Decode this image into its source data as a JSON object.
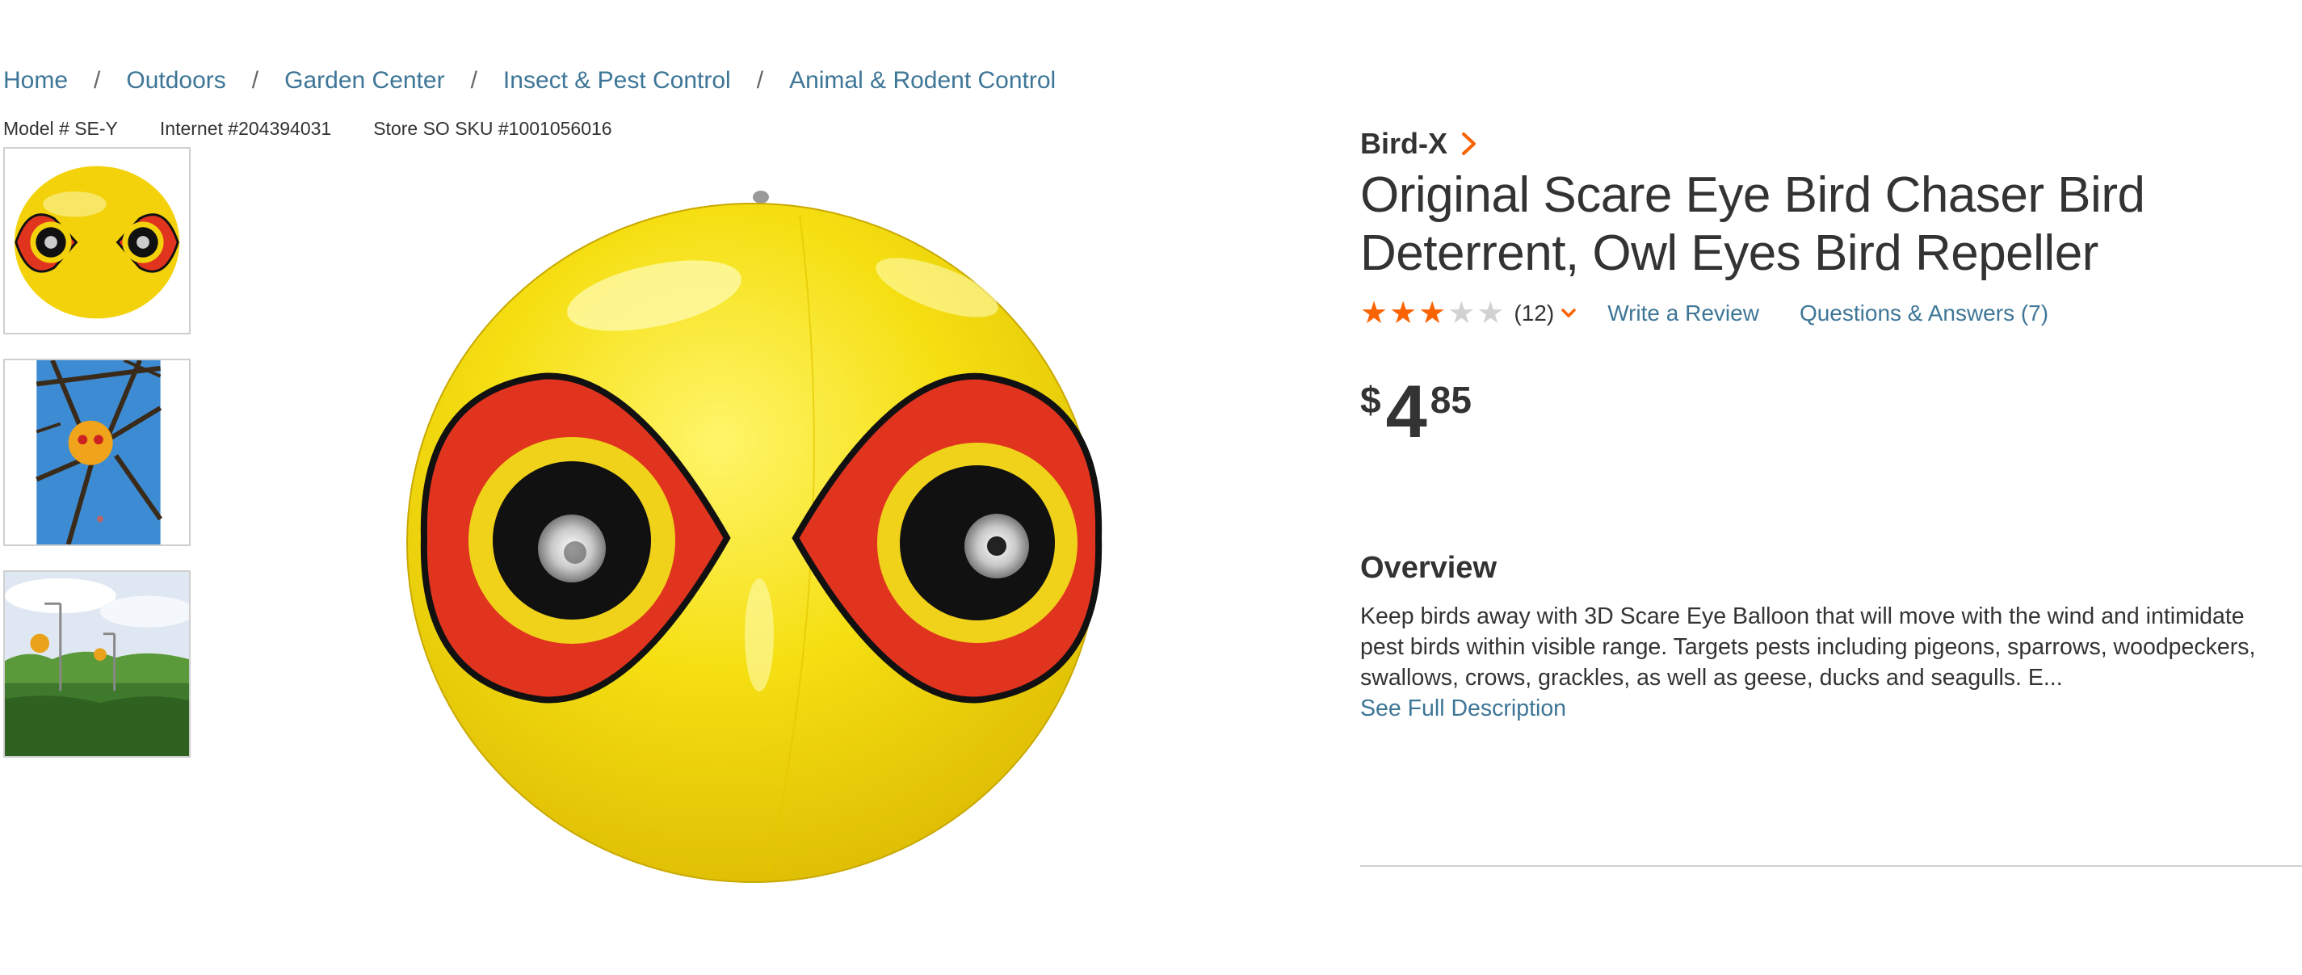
{
  "breadcrumb": {
    "items": [
      {
        "label": "Home"
      },
      {
        "label": "Outdoors"
      },
      {
        "label": "Garden Center"
      },
      {
        "label": "Insect & Pest Control"
      },
      {
        "label": "Animal & Rodent Control"
      }
    ],
    "separator": "/"
  },
  "model_info": {
    "model": "Model # SE-Y",
    "internet": "Internet #204394031",
    "store_sku": "Store SO SKU #1001056016"
  },
  "product": {
    "brand": "Bird-X",
    "title": "Original Scare Eye Bird Chaser Bird Deterrent, Owl Eyes Bird Repeller",
    "rating": {
      "value": 3,
      "max": 5,
      "count_text": "(12)"
    },
    "write_review": "Write a Review",
    "questions": "Questions & Answers (7)",
    "price": {
      "currency": "$",
      "dollars": "4",
      "cents": "85"
    }
  },
  "overview": {
    "heading": "Overview",
    "text": "Keep birds away with 3D Scare Eye Balloon that will move with the wind and intimidate pest birds within visible range. Targets pests including pigeons, sparrows, woodpeckers, swallows, crows, grackles, as well as geese, ducks and seagulls. E...",
    "see_full": "See Full Description"
  },
  "icons": {
    "brand_chevron": "chevron-right-icon",
    "rating_dropdown": "chevron-down-icon",
    "star": "star-icon"
  },
  "colors": {
    "accent": "#f96302",
    "link": "#3e7697",
    "text": "#333333",
    "balloon_yellow": "#f5d90a",
    "eye_red": "#e0341f"
  }
}
